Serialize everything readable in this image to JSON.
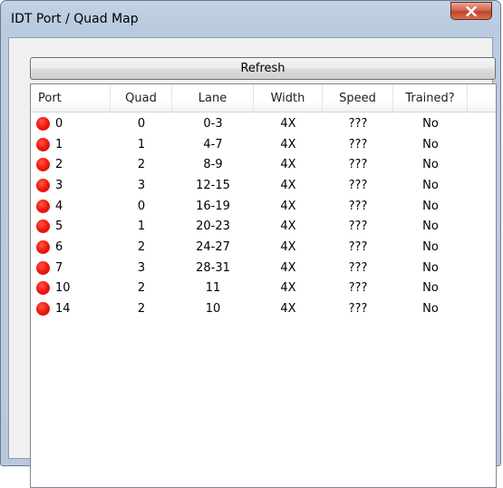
{
  "window": {
    "title": "IDT Port / Quad Map"
  },
  "toolbar": {
    "refresh_label": "Refresh"
  },
  "table": {
    "columns": [
      "Port",
      "Quad",
      "Lane",
      "Width",
      "Speed",
      "Trained?"
    ],
    "status_color": "#f21b12",
    "rows": [
      {
        "port": "0",
        "quad": "0",
        "lane": "0-3",
        "width": "4X",
        "speed": "???",
        "trained": "No"
      },
      {
        "port": "1",
        "quad": "1",
        "lane": "4-7",
        "width": "4X",
        "speed": "???",
        "trained": "No"
      },
      {
        "port": "2",
        "quad": "2",
        "lane": "8-9",
        "width": "4X",
        "speed": "???",
        "trained": "No"
      },
      {
        "port": "3",
        "quad": "3",
        "lane": "12-15",
        "width": "4X",
        "speed": "???",
        "trained": "No"
      },
      {
        "port": "4",
        "quad": "0",
        "lane": "16-19",
        "width": "4X",
        "speed": "???",
        "trained": "No"
      },
      {
        "port": "5",
        "quad": "1",
        "lane": "20-23",
        "width": "4X",
        "speed": "???",
        "trained": "No"
      },
      {
        "port": "6",
        "quad": "2",
        "lane": "24-27",
        "width": "4X",
        "speed": "???",
        "trained": "No"
      },
      {
        "port": "7",
        "quad": "3",
        "lane": "28-31",
        "width": "4X",
        "speed": "???",
        "trained": "No"
      },
      {
        "port": "10",
        "quad": "2",
        "lane": "11",
        "width": "4X",
        "speed": "???",
        "trained": "No"
      },
      {
        "port": "14",
        "quad": "2",
        "lane": "10",
        "width": "4X",
        "speed": "???",
        "trained": "No"
      }
    ]
  }
}
